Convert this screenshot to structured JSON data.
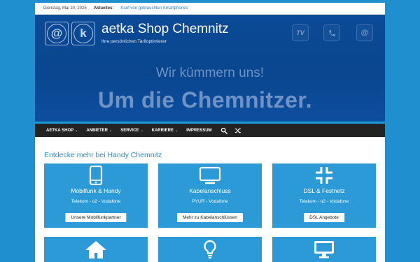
{
  "topbar": {
    "date": "Dienstag, Mai 20, 2025",
    "news_label": "Aktuelles:",
    "news_link": "Kauf von gebrauchten Smartphones"
  },
  "header": {
    "logo_letters": [
      "@",
      "k"
    ],
    "title": "aetka Shop Chemnitz",
    "tagline": "Ihre persönlichen Tarifoptimierer",
    "icon_tv": "TV",
    "icon_at": "@",
    "slogan_line1": "Wir kümmern uns!",
    "slogan_line2": "Um die Chemnitzer."
  },
  "nav": {
    "items": [
      {
        "label": "AETKA SHOP"
      },
      {
        "label": "ANBIETER"
      },
      {
        "label": "SERVICE"
      },
      {
        "label": "KARRIERE"
      },
      {
        "label": "IMPRESSUM"
      }
    ],
    "caret": "⌄"
  },
  "section": {
    "title": "Entdecke mehr bei Handy Chemnitz"
  },
  "cards": [
    {
      "title": "Mobilfunk & Handy",
      "providers": "Telekom - o2 - Vodafone",
      "button": "Unsere Mobilfunkpartner",
      "icon": "smartphone-icon"
    },
    {
      "title": "Kabelanschluss",
      "providers": "PYUR - Vodafone",
      "button": "Mehr zu Kabelanschlüssen",
      "icon": "monitor-icon"
    },
    {
      "title": "DSL & Festnetz",
      "providers": "Telekom - o2 - Vodafone",
      "button": "DSL Angebote",
      "icon": "compress-icon"
    },
    {
      "icon": "home-icon"
    },
    {
      "icon": "lightbulb-icon"
    },
    {
      "icon": "desktop-icon"
    }
  ],
  "colors": {
    "page_bg": "#1f8fd0",
    "header_bg": "#0b4a96",
    "nav_bg": "#232323",
    "card_bg": "#2c9ad6",
    "accent": "#2a8dd0"
  }
}
